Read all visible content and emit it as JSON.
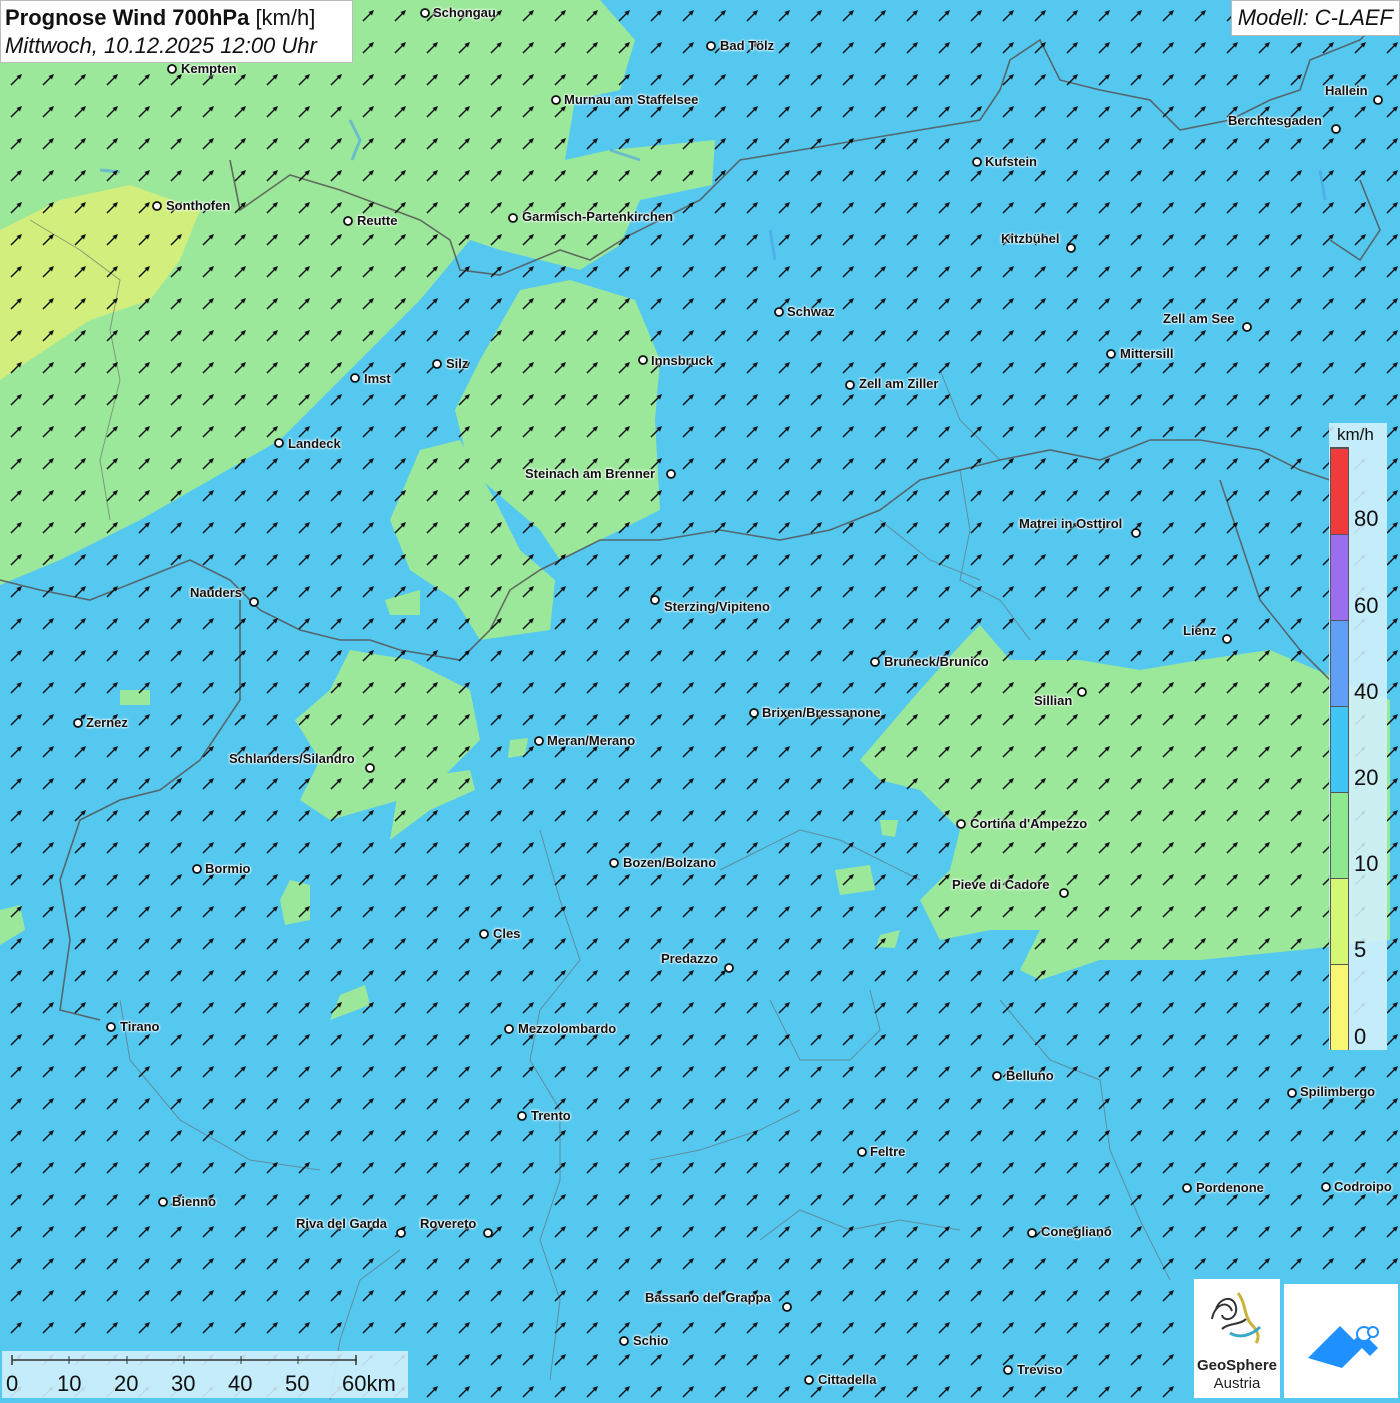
{
  "title": {
    "main": "Prognose Wind 700hPa",
    "unit": "[km/h]",
    "datetime": "Mittwoch, 10.12.2025 12:00 Uhr"
  },
  "model_label": "Modell: C-LAEF",
  "legend": {
    "unit": "km/h",
    "labels": [
      "80",
      "60",
      "40",
      "20",
      "10",
      "5",
      "0"
    ],
    "bins": [
      {
        "from": 80,
        "color": "#ef3b3b"
      },
      {
        "from": 60,
        "color": "#9b6ef0"
      },
      {
        "from": 40,
        "color": "#5f9ff5"
      },
      {
        "from": 20,
        "color": "#3fc6f4"
      },
      {
        "from": 10,
        "color": "#8ee88e"
      },
      {
        "from": 5,
        "color": "#d4f774"
      },
      {
        "from": 0,
        "color": "#f8f774"
      }
    ]
  },
  "scale_bar": {
    "labels": [
      "0",
      "10",
      "20",
      "30",
      "40",
      "50",
      "60km"
    ]
  },
  "logo": {
    "name": "GeoSphere",
    "sub": "Austria"
  },
  "colors": {
    "wind_10_20": "#55c8f0",
    "wind_5_10": "#9ce89a",
    "wind_0_5": "#d8f07a",
    "arrow": "#0b0b0b",
    "border": "#555555"
  },
  "wind_arrows": {
    "direction": "south-west wind, arrows pointing north-east"
  },
  "cities": [
    "Schongau",
    "Bad Tölz",
    "Kempten",
    "Murnau am Staffelsee",
    "Hallein",
    "Berchtesgaden",
    "Kufstein",
    "Sonthofen",
    "Reutte",
    "Garmisch-Partenkirchen",
    "Kitzbühel",
    "Schwaz",
    "Zell am See",
    "Innsbruck",
    "Mittersill",
    "Silz",
    "Imst",
    "Zell am Ziller",
    "Landeck",
    "Steinach am Brenner",
    "Matrei in Osttirol",
    "Nauders",
    "Sterzing/Vipiteno",
    "Lienz",
    "Bruneck/Brunico",
    "Sillian",
    "Brixen/Bressanone",
    "Zernez",
    "Meran/Merano",
    "Schlanders/Silandro",
    "Cortina d'Ampezzo",
    "Bozen/Bolzano",
    "Bormio",
    "Pieve di Cadore",
    "Cles",
    "Predazzo",
    "Tirano",
    "Mezzolombardo",
    "Belluno",
    "Spilimbergo",
    "Trento",
    "Feltre",
    "Pordenone",
    "Codroipo",
    "Bienno",
    "Riva del Garda",
    "Rovereto",
    "Conegliano",
    "Bassano del Grappa",
    "Schio",
    "Treviso",
    "Cittadella"
  ]
}
